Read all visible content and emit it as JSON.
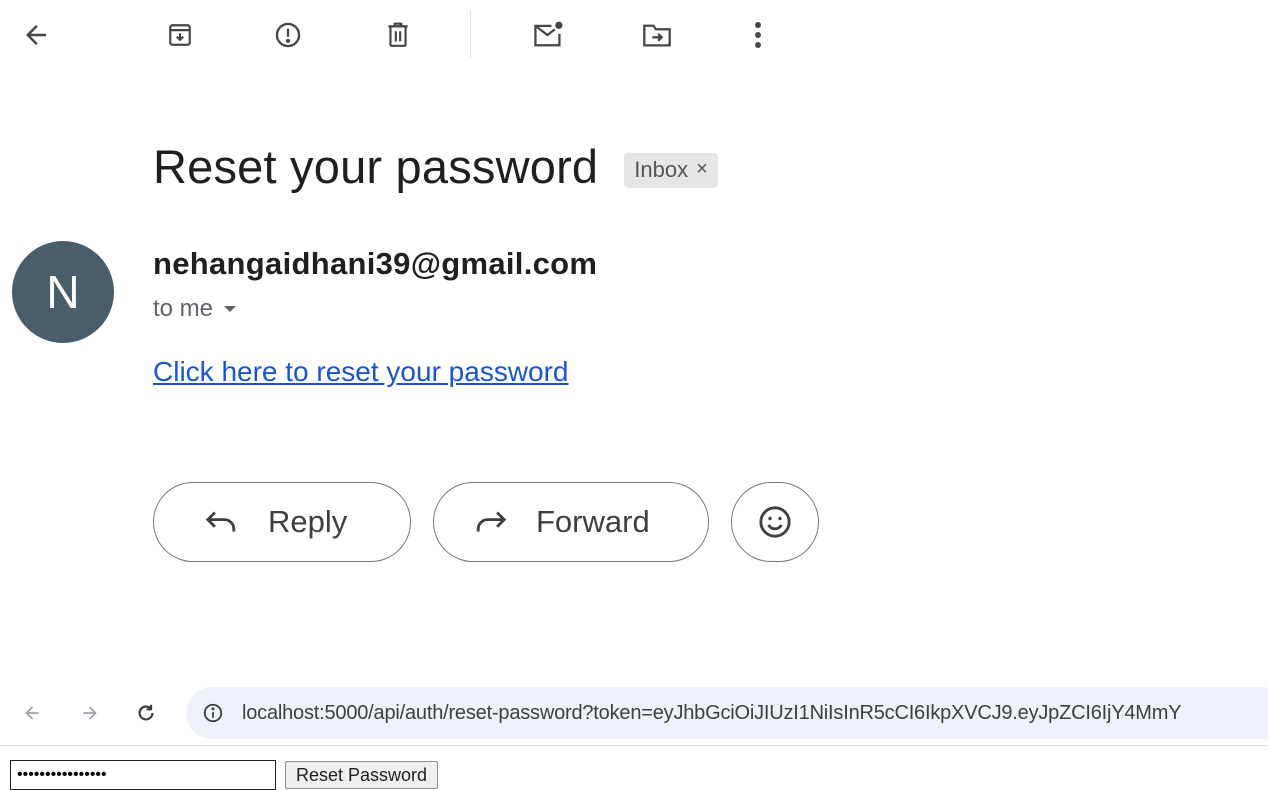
{
  "toolbar": {
    "icons": [
      "back-arrow-icon",
      "archive-icon",
      "report-spam-icon",
      "delete-icon",
      "mark-unread-icon",
      "move-to-icon",
      "more-vert-icon"
    ]
  },
  "email": {
    "subject": "Reset your password",
    "label": "Inbox",
    "label_close": "×",
    "sender_initial": "N",
    "sender_email": "nehangaidhani39@gmail.com",
    "recipient": "to me",
    "link_text": "Click here to reset your password"
  },
  "actions": {
    "reply_label": "Reply",
    "forward_label": "Forward"
  },
  "browser": {
    "url": "localhost:5000/api/auth/reset-password?token=eyJhbGciOiJIUzI1NiIsInR5cCI6IkpXVCJ9.eyJpZCI6IjY4MmY"
  },
  "reset_form": {
    "password_value": "••••••••••••••••",
    "button_label": "Reset Password"
  },
  "colors": {
    "avatar_bg": "#4a5d6b",
    "link": "#1a55d0",
    "chip_bg": "#e6e6e6",
    "url_bar_bg": "#eef1f7"
  }
}
